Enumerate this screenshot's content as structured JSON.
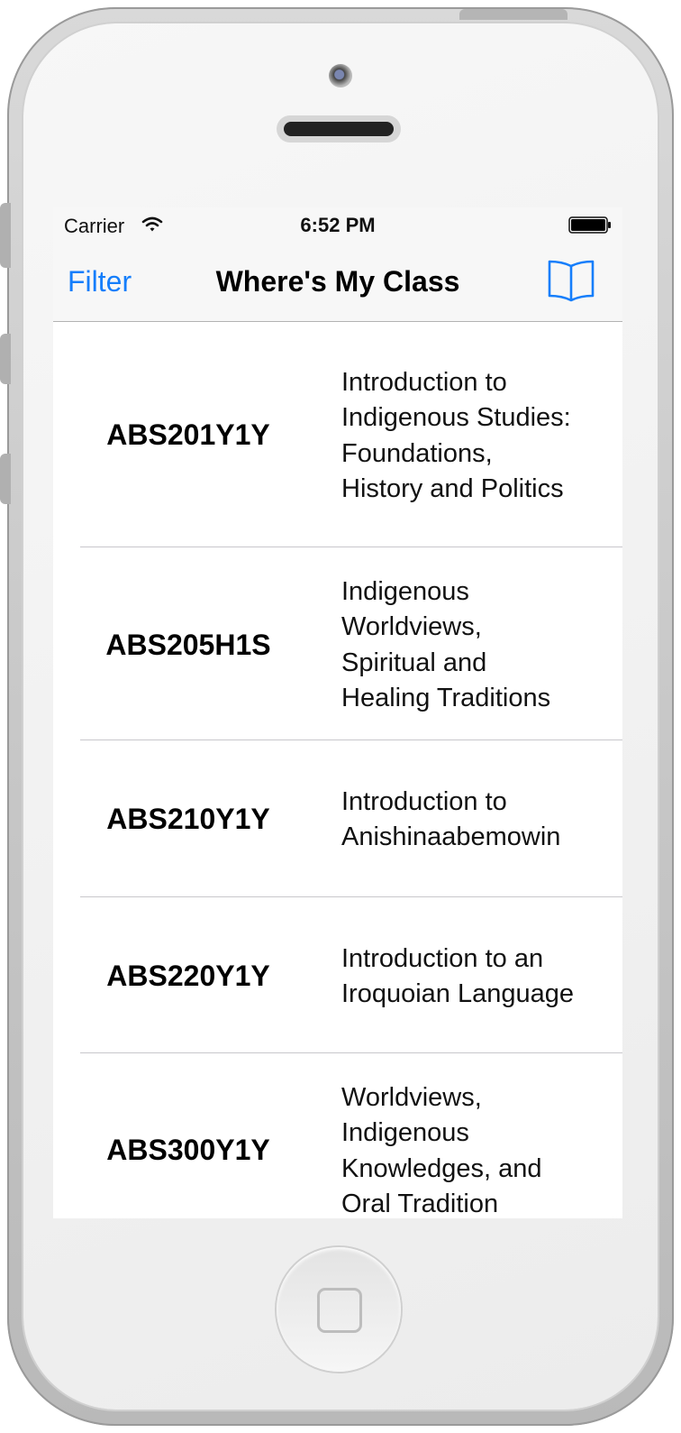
{
  "status_bar": {
    "carrier": "Carrier",
    "time": "6:52 PM",
    "wifi_icon": "wifi-icon",
    "battery_icon": "battery-icon"
  },
  "nav_bar": {
    "left_button": "Filter",
    "title": "Where's My Class",
    "right_button_icon": "book-icon"
  },
  "colors": {
    "accent": "#157efb",
    "separator": "#c8c7cc",
    "nav_background": "#f7f7f7"
  },
  "courses": [
    {
      "code": "ABS201Y1Y",
      "title_lines": [
        "Introduction to",
        "Indigenous Studies:",
        "Foundations,",
        "History and Politics"
      ]
    },
    {
      "code": "ABS205H1S",
      "title_lines": [
        "Indigenous",
        "Worldviews,",
        "Spiritual and",
        "Healing Traditions"
      ]
    },
    {
      "code": "ABS210Y1Y",
      "title_lines": [
        "Introduction to",
        "Anishinaabemowin"
      ]
    },
    {
      "code": "ABS220Y1Y",
      "title_lines": [
        "Introduction to an",
        "Iroquoian Language"
      ]
    },
    {
      "code": "ABS300Y1Y",
      "title_lines": [
        "Worldviews,",
        "Indigenous",
        "Knowledges, and",
        "Oral Tradition"
      ]
    }
  ]
}
